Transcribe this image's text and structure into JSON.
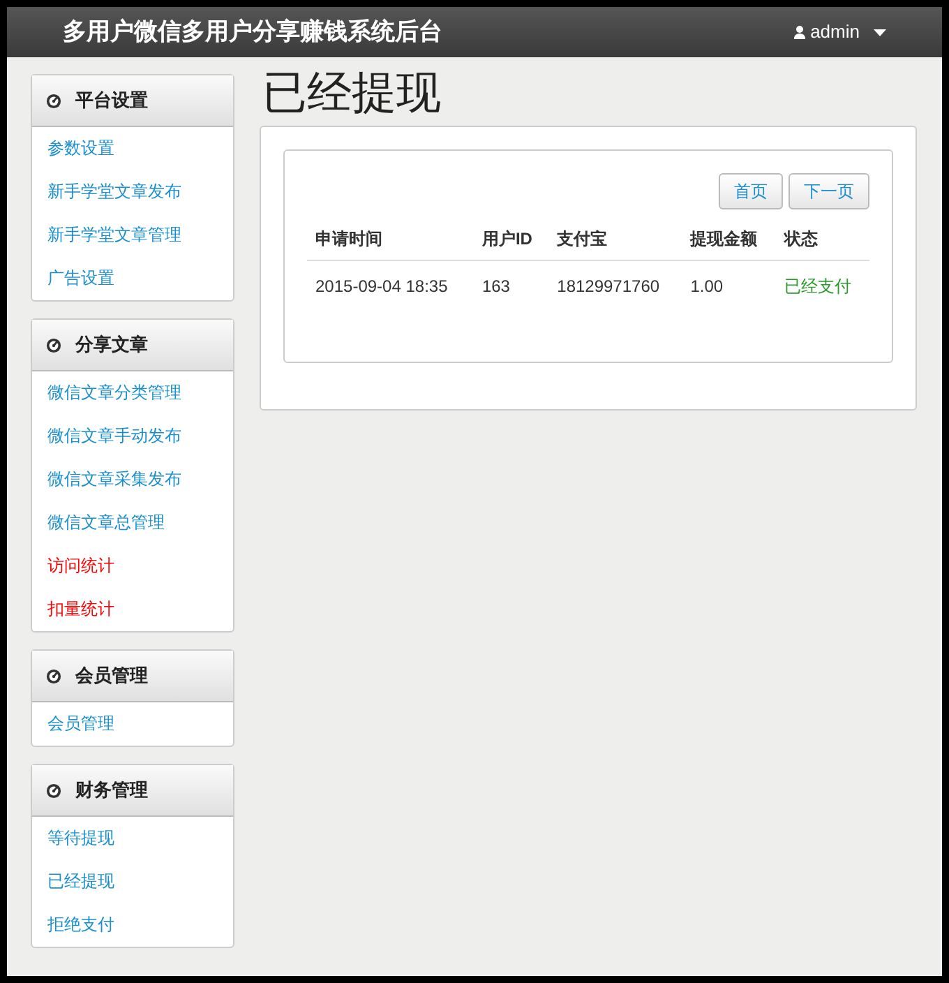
{
  "navbar": {
    "title": "多用户微信多用户分享赚钱系统后台",
    "user": "admin"
  },
  "sidebar": [
    {
      "title": "平台设置",
      "items": [
        {
          "label": "参数设置",
          "color": "#1a8fd0"
        },
        {
          "label": "新手学堂文章发布",
          "color": "#1a8fd0"
        },
        {
          "label": "新手学堂文章管理",
          "color": "#1a8fd0"
        },
        {
          "label": "广告设置",
          "color": "#1a8fd0"
        }
      ]
    },
    {
      "title": "分享文章",
      "items": [
        {
          "label": "微信文章分类管理",
          "color": "#1a8fd0"
        },
        {
          "label": "微信文章手动发布",
          "color": "#1a8fd0"
        },
        {
          "label": "微信文章采集发布",
          "color": "#1a8fd0"
        },
        {
          "label": "微信文章总管理",
          "color": "#1a8fd0"
        },
        {
          "label": "访问统计",
          "color": "#ff0000"
        },
        {
          "label": "扣量统计",
          "color": "#ff0000"
        }
      ]
    },
    {
      "title": "会员管理",
      "items": [
        {
          "label": "会员管理",
          "color": "#1a8fd0"
        }
      ]
    },
    {
      "title": "财务管理",
      "items": [
        {
          "label": "等待提现",
          "color": "#1a8fd0"
        },
        {
          "label": "已经提现",
          "color": "#1a8fd0"
        },
        {
          "label": "拒绝支付",
          "color": "#1a8fd0"
        }
      ]
    }
  ],
  "page_title": "已经提现",
  "pager": [
    "首页",
    "下一页"
  ],
  "table": {
    "columns": [
      {
        "label": "申请时间",
        "kind": "text"
      },
      {
        "label": "用户ID",
        "kind": "text"
      },
      {
        "label": "支付宝",
        "kind": "text"
      },
      {
        "label": "提现金额",
        "kind": "text"
      },
      {
        "label": "状态",
        "kind": "status"
      }
    ],
    "rows": [
      [
        "2015-09-04 18:35",
        "163",
        "18129971760",
        "1.00",
        "已经支付"
      ]
    ]
  }
}
